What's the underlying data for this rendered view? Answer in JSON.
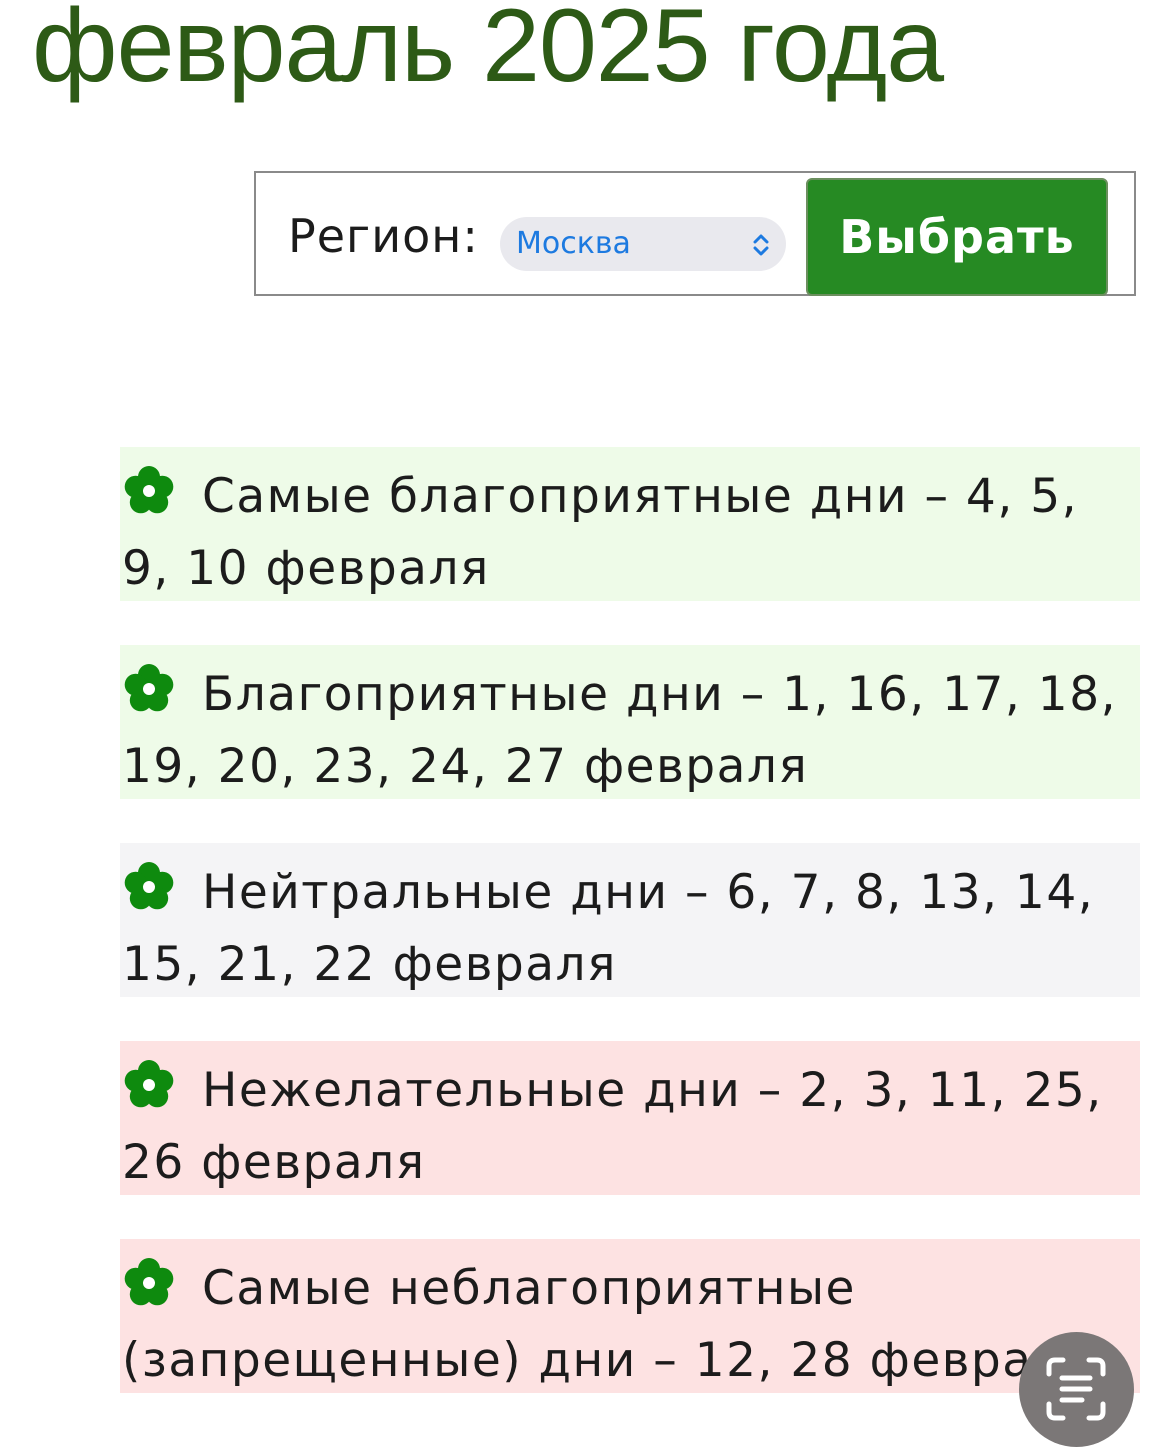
{
  "header": {
    "title": "февраль 2025 года"
  },
  "region_form": {
    "label": "Регион:",
    "selected_region": "Москва",
    "button_label": "Выбрать"
  },
  "day_categories": [
    {
      "text": "Самые благоприятные дни – 4, 5, 9, 10 февраля",
      "background": "#eefbe8"
    },
    {
      "text": "Благоприятные дни – 1, 16, 17, 18, 19, 20, 23, 24, 27 февраля",
      "background": "#eefbe8"
    },
    {
      "text": "Нейтральные дни – 6, 7, 8, 13, 14, 15, 21, 22 февраля",
      "background": "#f4f4f6"
    },
    {
      "text": "Нежелательные дни – 2, 3, 11, 25, 26 февраля",
      "background": "#fde2e2"
    },
    {
      "text": "Самые неблагоприятные (запрещенные) дни – 12, 28 февраля",
      "background": "#fde2e2"
    }
  ],
  "colors": {
    "title": "#2d5a16",
    "button": "#268a23",
    "flower": "#0e8a0e",
    "select_text": "#1d7ae0"
  },
  "icons": {
    "bullet": "flower-icon",
    "select": "chevron-up-down-icon",
    "scan": "text-scan-icon"
  }
}
